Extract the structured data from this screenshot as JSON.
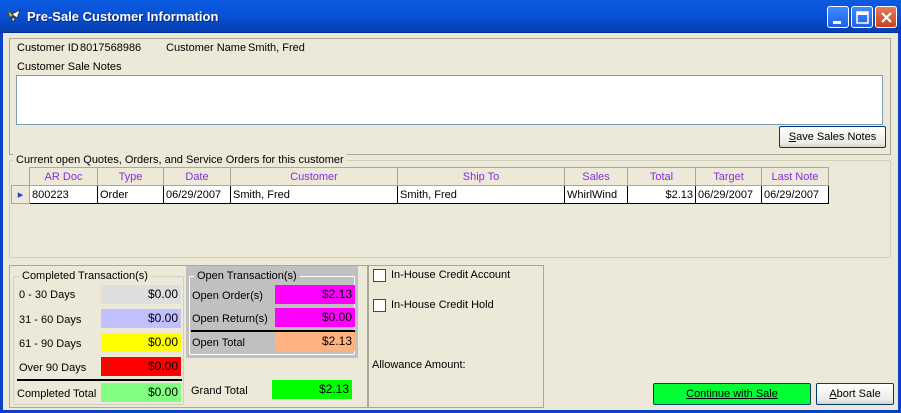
{
  "window": {
    "title": "Pre-Sale Customer Information"
  },
  "customer": {
    "id_label": "Customer ID",
    "id_value": "8017568986",
    "name_label": "Customer Name",
    "name_value": "Smith, Fred",
    "notes_label": "Customer Sale Notes",
    "notes_value": "",
    "save_notes_button": "Save Sales Notes"
  },
  "orders": {
    "group_label": "Current open Quotes, Orders, and Service Orders for this customer",
    "columns": [
      "AR Doc",
      "Type",
      "Date",
      "Customer",
      "Ship To",
      "Sales",
      "Total",
      "Target",
      "Last Note"
    ],
    "rows": [
      [
        "800223",
        "Order",
        "06/29/2007",
        "Smith, Fred",
        "Smith, Fred",
        "WhirlWind",
        "$2.13",
        "06/29/2007",
        "06/29/2007"
      ]
    ]
  },
  "completed": {
    "label": "Completed Transaction(s)",
    "rows": [
      {
        "label": "0 - 30 Days",
        "value": "$0.00",
        "color": "#DEDEDE"
      },
      {
        "label": "31 - 60 Days",
        "value": "$0.00",
        "color": "#C0C0FF"
      },
      {
        "label": "61 - 90 Days",
        "value": "$0.00",
        "color": "#FFFF00"
      },
      {
        "label": "Over 90 Days",
        "value": "$0.00",
        "color": "#FF0000"
      }
    ],
    "total_label": "Completed Total",
    "total_value": "$0.00",
    "total_color": "#80FF80"
  },
  "open": {
    "label": "Open Transaction(s)",
    "orders_label": "Open Order(s)",
    "orders_value": "$2.13",
    "returns_label": "Open Return(s)",
    "returns_value": "$0.00",
    "total_label": "Open Total",
    "total_value": "$2.13",
    "magenta": "#FF00FF",
    "peach": "#FFB380"
  },
  "grand": {
    "label": "Grand Total",
    "value": "$2.13",
    "color": "#00FF00"
  },
  "credit": {
    "account_label": "In-House Credit Account",
    "hold_label": "In-House Credit Hold",
    "allowance_label": "Allowance Amount:"
  },
  "actions": {
    "continue_label": "Continue with Sale",
    "abort_label": "Abort Sale"
  }
}
